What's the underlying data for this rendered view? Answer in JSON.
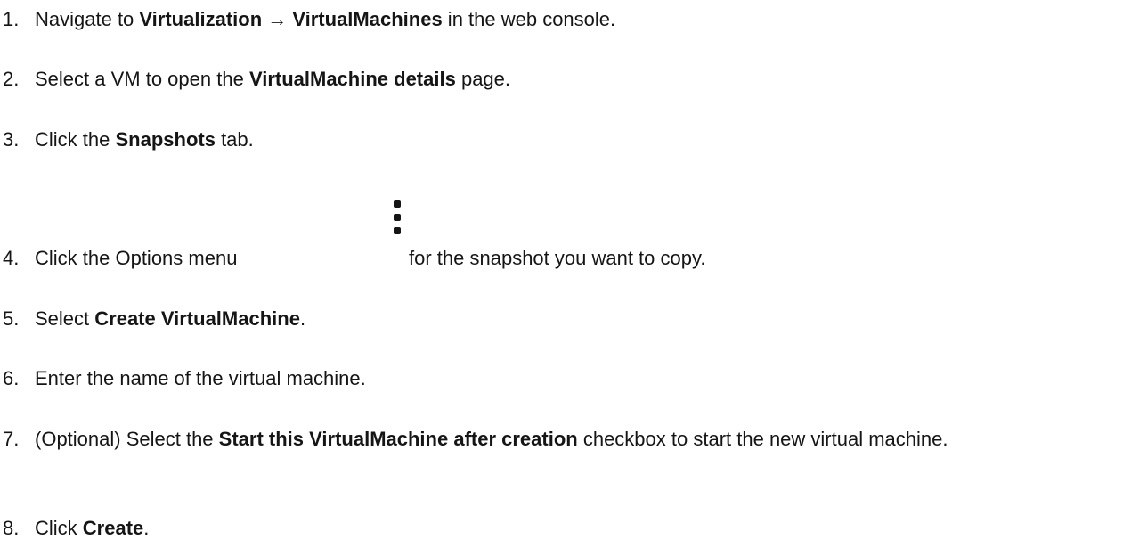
{
  "steps": [
    {
      "num": "1.",
      "parts": [
        "Navigate to ",
        "Virtualization → VirtualMachines",
        " in the web console."
      ]
    },
    {
      "num": "2.",
      "parts": [
        "Select a VM to open the ",
        "VirtualMachine details",
        " page."
      ]
    },
    {
      "num": "3.",
      "parts": [
        "Click the ",
        "Snapshots",
        " tab."
      ]
    },
    {
      "num": "4.",
      "parts": [
        "Click the Options menu",
        "for the snapshot you want to copy."
      ],
      "icon": "kebab-options-icon"
    },
    {
      "num": "5.",
      "parts": [
        "Select ",
        "Create VirtualMachine",
        "."
      ]
    },
    {
      "num": "6.",
      "parts": [
        "Enter the name of the virtual machine."
      ]
    },
    {
      "num": "7.",
      "parts": [
        "(Optional) Select the ",
        "Start this VirtualMachine after creation",
        " checkbox to start the new virtual machine."
      ]
    },
    {
      "num": "8.",
      "parts": [
        "Click ",
        "Create",
        "."
      ]
    }
  ]
}
